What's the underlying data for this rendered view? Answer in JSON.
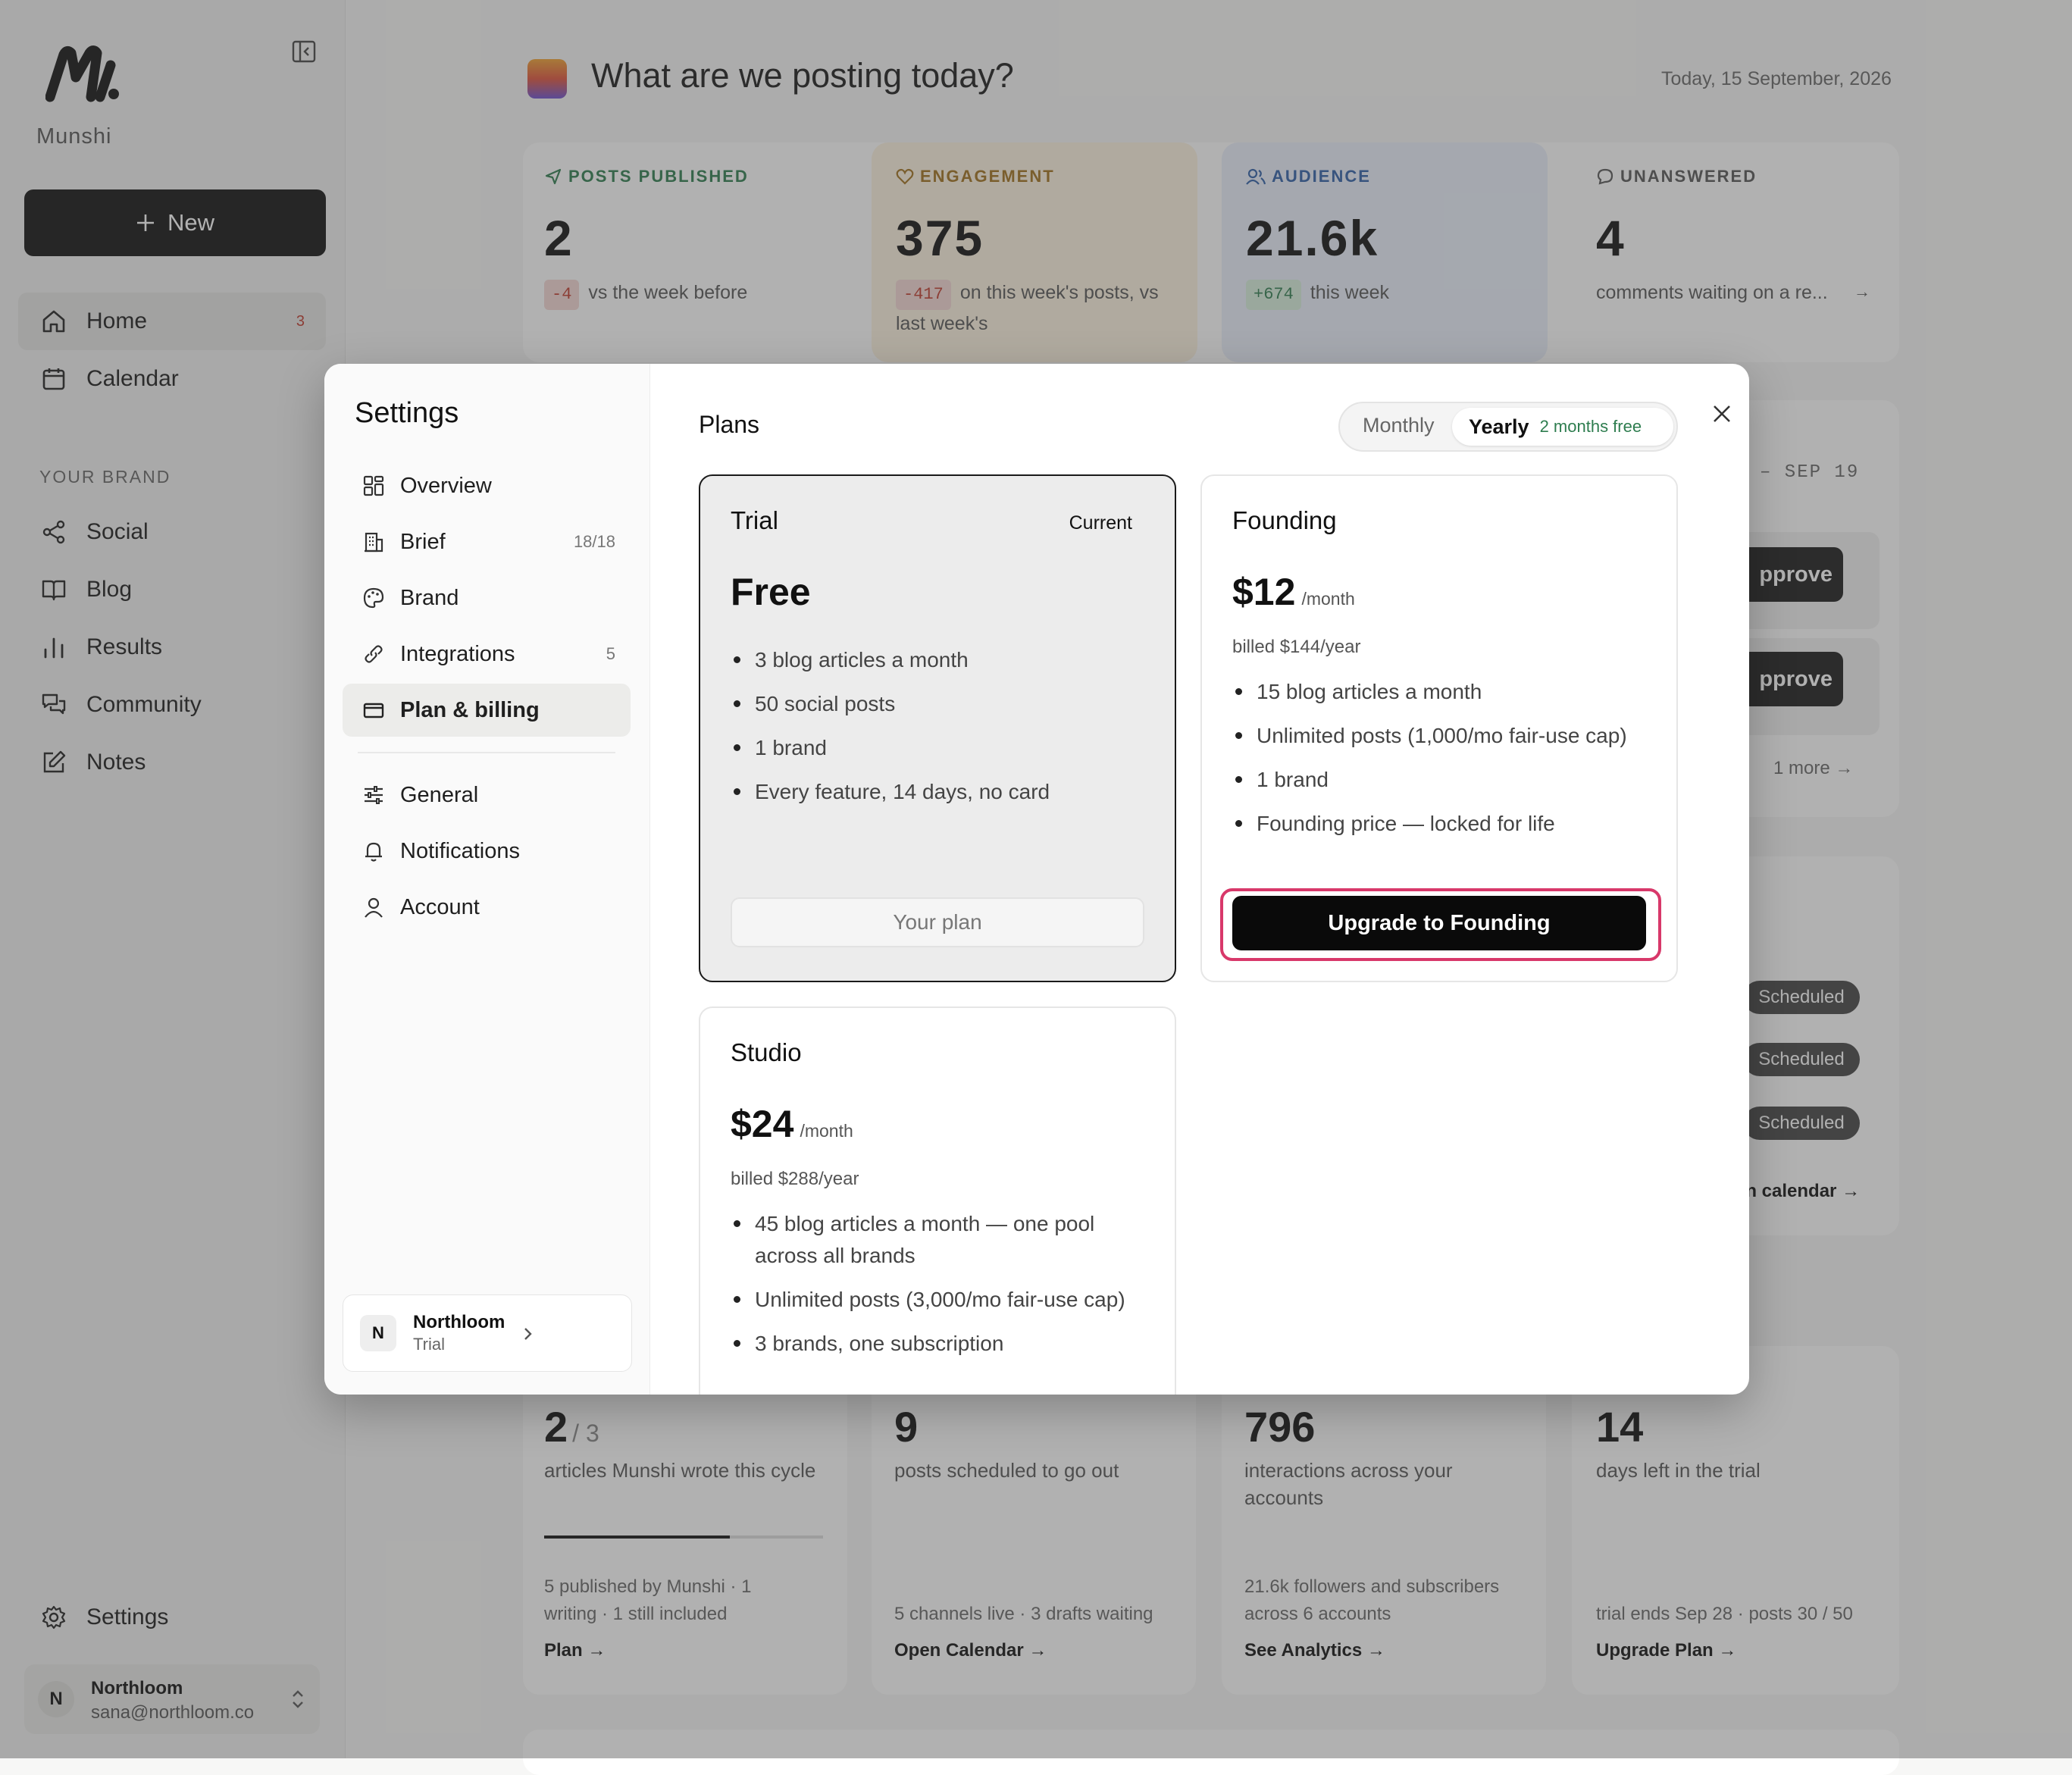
{
  "app": {
    "brand": "Munshi",
    "new_label": "New"
  },
  "sidebar": {
    "primary": [
      {
        "label": "Home",
        "badge": "3",
        "icon": "home-icon"
      },
      {
        "label": "Calendar",
        "icon": "calendar-icon"
      }
    ],
    "section_label": "YOUR BRAND",
    "brand_items": [
      {
        "label": "Social",
        "icon": "share-icon"
      },
      {
        "label": "Blog",
        "icon": "book-icon"
      },
      {
        "label": "Results",
        "icon": "bar-chart-icon"
      },
      {
        "label": "Community",
        "icon": "chat-icon"
      },
      {
        "label": "Notes",
        "icon": "edit-icon"
      }
    ],
    "settings_label": "Settings",
    "user": {
      "initial": "N",
      "name": "Northloom",
      "email": "sana@northloom.co"
    }
  },
  "header": {
    "title": "What are we posting today?",
    "date": "Today, 15 September, 2026"
  },
  "stats": [
    {
      "label": "POSTS PUBLISHED",
      "value": "2",
      "delta": "-4",
      "sub": "vs the week before",
      "color": "#2e7d4f"
    },
    {
      "label": "ENGAGEMENT",
      "value": "375",
      "delta": "-417",
      "sub": "on this week's posts, vs last week's",
      "color": "#a0701c"
    },
    {
      "label": "AUDIENCE",
      "value": "21.6k",
      "delta": "+674",
      "sub": "this week",
      "color": "#2f5fa8"
    },
    {
      "label": "UNANSWERED",
      "value": "4",
      "sub": "comments waiting on a re..."
    }
  ],
  "background_right": {
    "date_range": "– SEP 19",
    "approve_label": "pprove",
    "more_label": "1 more",
    "scheduled_label": "Scheduled",
    "calendar_link": "en calendar →"
  },
  "bottom_cards": [
    {
      "value": "2",
      "total": "/ 3",
      "desc": "articles Munshi wrote this cycle",
      "progress": 0.667,
      "foot": "5 published by Munshi · 1 writing · 1 still included",
      "link": "Plan →"
    },
    {
      "value": "9",
      "desc": "posts scheduled to go out",
      "foot": "5 channels live · 3 drafts waiting",
      "link": "Open Calendar →"
    },
    {
      "value": "796",
      "desc": "interactions across your accounts",
      "foot": "21.6k followers and subscribers across 6 accounts",
      "link": "See Analytics →"
    },
    {
      "value": "14",
      "desc": "days left in the trial",
      "foot": "trial ends Sep 28 · posts 30 / 50",
      "link": "Upgrade Plan →"
    }
  ],
  "settings": {
    "title": "Settings",
    "nav": [
      {
        "label": "Overview",
        "icon": "grid-icon"
      },
      {
        "label": "Brief",
        "count": "18/18",
        "icon": "building-icon"
      },
      {
        "label": "Brand",
        "icon": "palette-icon"
      },
      {
        "label": "Integrations",
        "count": "5",
        "icon": "link-icon"
      },
      {
        "label": "Plan & billing",
        "icon": "credit-card-icon",
        "active": true
      },
      {
        "label": "General",
        "icon": "sliders-icon"
      },
      {
        "label": "Notifications",
        "icon": "bell-icon"
      },
      {
        "label": "Account",
        "icon": "user-icon"
      }
    ],
    "workspace": {
      "initial": "N",
      "name": "Northloom",
      "plan": "Trial"
    }
  },
  "plans": {
    "title": "Plans",
    "toggle": {
      "monthly": "Monthly",
      "yearly": "Yearly",
      "yearly_note": "2 months free",
      "selected": "Yearly"
    },
    "cards": [
      {
        "name": "Trial",
        "current_label": "Current",
        "price": "Free",
        "features": [
          "3 blog articles a month",
          "50 social posts",
          "1 brand",
          "Every feature, 14 days, no card"
        ],
        "cta": "Your plan"
      },
      {
        "name": "Founding",
        "price": "$12",
        "per": "/month",
        "billed": "billed $144/year",
        "features": [
          "15 blog articles a month",
          "Unlimited posts (1,000/mo fair-use cap)",
          "1 brand",
          "Founding price — locked for life"
        ],
        "cta": "Upgrade to Founding"
      },
      {
        "name": "Studio",
        "price": "$24",
        "per": "/month",
        "billed": "billed $288/year",
        "features": [
          "45 blog articles a month — one pool across all brands",
          "Unlimited posts (3,000/mo fair-use cap)",
          "3 brands, one subscription"
        ]
      }
    ]
  }
}
